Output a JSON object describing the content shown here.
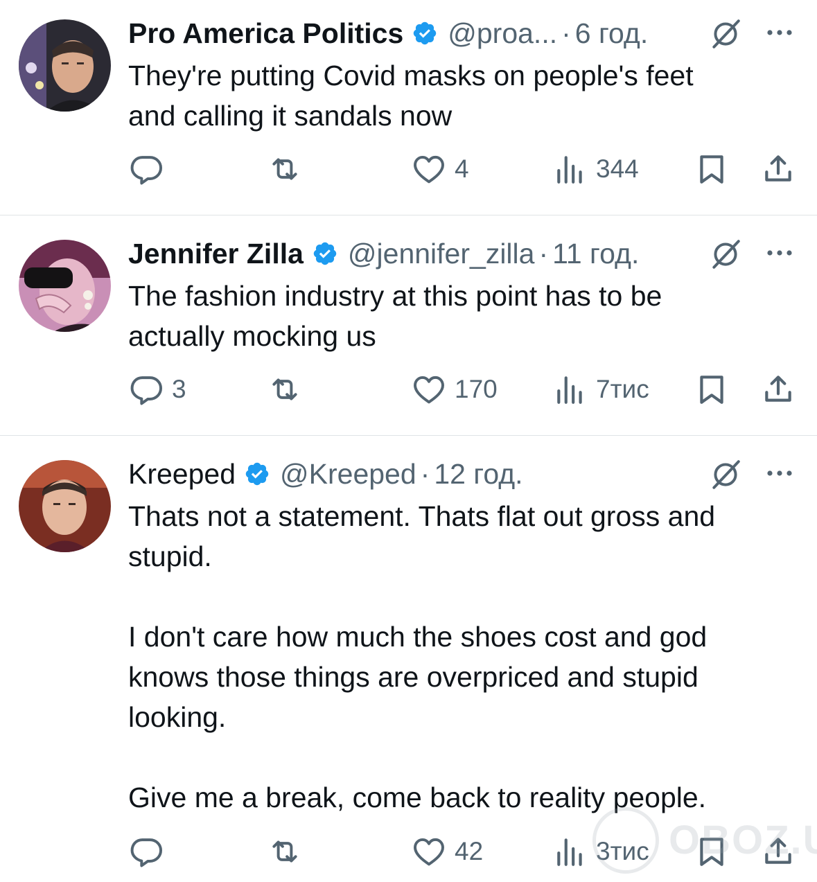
{
  "tweets": [
    {
      "author_name": "Pro America Politics",
      "handle": "@proa...",
      "separator": "·",
      "time": "6 год.",
      "verified": true,
      "text": "They're putting Covid masks on people's feet\nand calling it sandals now",
      "replies": "",
      "retweets": "",
      "likes": "4",
      "views": "344"
    },
    {
      "author_name": "Jennifer Zilla",
      "handle": "@jennifer_zilla",
      "separator": "·",
      "time": "11 год.",
      "verified": true,
      "text": "The fashion industry at this point has to be\nactually mocking us",
      "replies": "3",
      "retweets": "",
      "likes": "170",
      "views": "7тис"
    },
    {
      "author_name": "Kreeped",
      "handle": "@Kreeped",
      "separator": "·",
      "time": "12 год.",
      "verified": true,
      "text": "Thats not a statement. Thats flat out gross and\nstupid.\n\nI don't care how much the shoes cost and god\nknows those things are overpriced and stupid\nlooking.\n\nGive me a break, come back to reality people.",
      "replies": "",
      "retweets": "",
      "likes": "42",
      "views": "3тис"
    }
  ],
  "watermark": {
    "text": "OBOZ.UA"
  },
  "colors": {
    "text": "#0f1419",
    "secondary": "#536471",
    "verified_badge": "#1d9bf0",
    "divider": "#dfe3e6"
  },
  "icons": {
    "reply": "reply-bubble-icon",
    "retweet": "retweet-arrows-icon",
    "like": "heart-icon",
    "views": "bar-chart-icon",
    "bookmark": "bookmark-icon",
    "share": "share-upload-icon",
    "grok": "grok-slash-circle-icon",
    "more": "more-dots-icon",
    "verified": "verified-badge-icon"
  }
}
